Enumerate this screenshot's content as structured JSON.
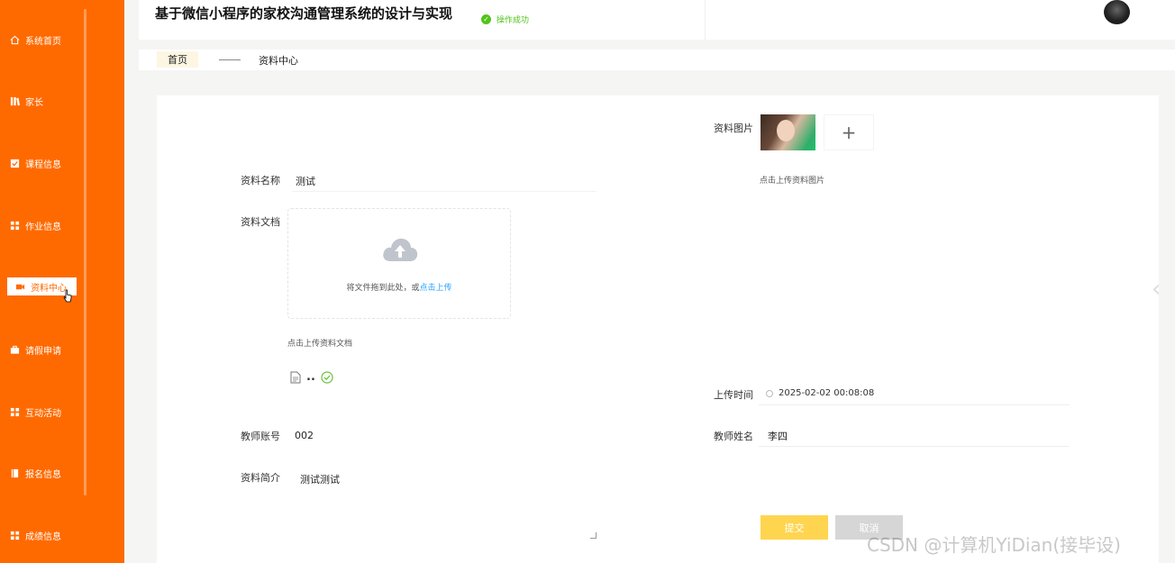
{
  "sidebar": {
    "items": [
      {
        "label": "系统首页",
        "icon": "home-icon"
      },
      {
        "label": "家长",
        "icon": "bars-icon"
      },
      {
        "label": "课程信息",
        "icon": "check-square-icon"
      },
      {
        "label": "作业信息",
        "icon": "grid-icon"
      },
      {
        "label": "资料中心",
        "icon": "film-icon",
        "active": true
      },
      {
        "label": "请假申请",
        "icon": "briefcase-icon"
      },
      {
        "label": "互动活动",
        "icon": "grid-icon"
      },
      {
        "label": "报名信息",
        "icon": "book-icon"
      },
      {
        "label": "成绩信息",
        "icon": "grid-icon"
      }
    ]
  },
  "header": {
    "title": "基于微信小程序的家校沟通管理系统的设计与实现",
    "toast": "操作成功"
  },
  "tabs": {
    "home": "首页",
    "current": "资料中心"
  },
  "form": {
    "name_label": "资料名称",
    "name_value": "测试",
    "doc_label": "资料文档",
    "upload_tip_prefix": "将文件拖到此处，或",
    "upload_tip_link": "点击上传",
    "doc_hint": "点击上传资料文档",
    "file_name": "..",
    "image_label": "资料图片",
    "image_hint": "点击上传资料图片",
    "image_add": "+",
    "time_label": "上传时间",
    "time_value": "2025-02-02 00:08:08",
    "teacher_account_label": "教师账号",
    "teacher_account_value": "002",
    "teacher_name_label": "教师姓名",
    "teacher_name_value": "李四",
    "intro_label": "资料简介",
    "intro_value": "测试测试",
    "submit_label": "提交",
    "cancel_label": "取消"
  },
  "watermark": "CSDN @计算机YiDian(接毕设)",
  "colors": {
    "sidebar_bg": "#ff6a00",
    "submit_bg": "#ffd54f",
    "cancel_bg": "#d6d6d6",
    "success": "#52c41a",
    "link": "#1e9fff"
  }
}
